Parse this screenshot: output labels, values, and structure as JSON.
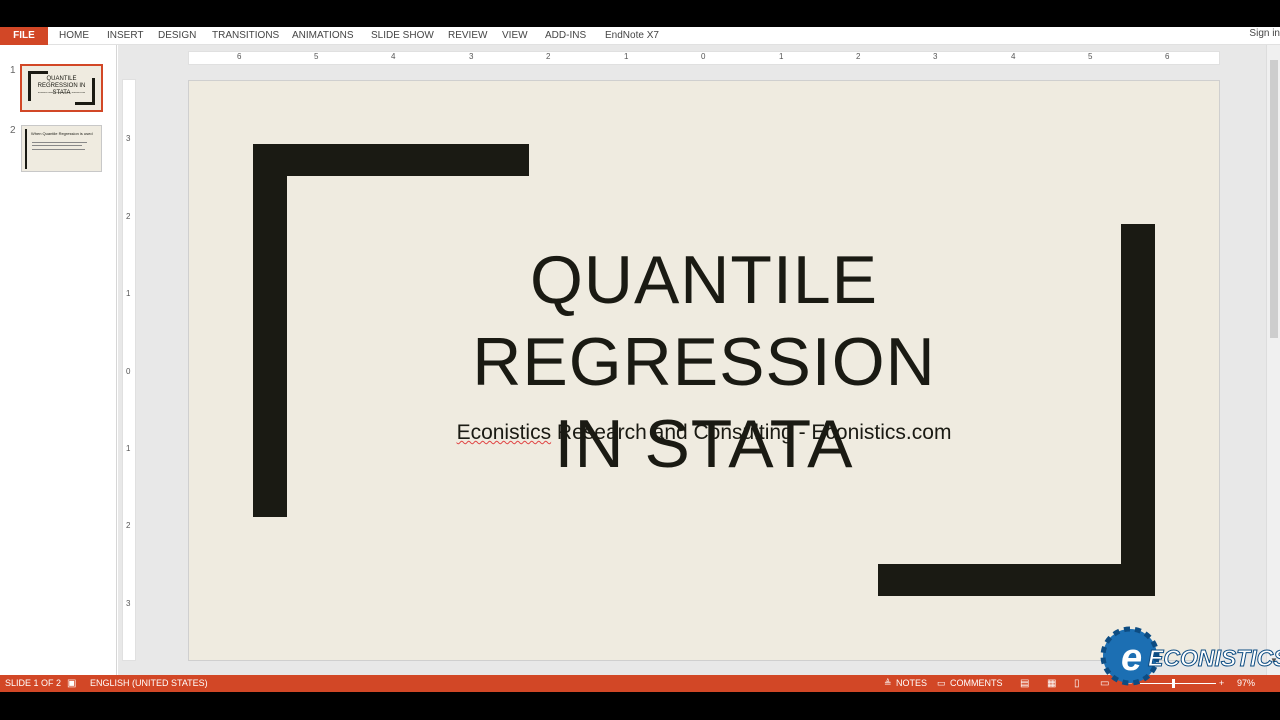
{
  "ribbon": {
    "file": "FILE",
    "tabs": [
      "HOME",
      "INSERT",
      "DESIGN",
      "TRANSITIONS",
      "ANIMATIONS",
      "SLIDE SHOW",
      "REVIEW",
      "VIEW",
      "ADD-INS",
      "EndNote X7"
    ],
    "signin": "Sign in"
  },
  "thumbnails": {
    "slide1": {
      "number": "1",
      "title": "QUANTILE REGRESSION IN STATA",
      "subtitle": "Econistics Research and Consulting - Econistics.com"
    },
    "slide2": {
      "number": "2",
      "title": "When Quantile Regression is used"
    }
  },
  "ruler": {
    "horizontal": [
      "6",
      "5",
      "4",
      "3",
      "2",
      "1",
      "0",
      "1",
      "2",
      "3",
      "4",
      "5",
      "6"
    ],
    "vertical": [
      "3",
      "2",
      "1",
      "0",
      "1",
      "2",
      "3"
    ]
  },
  "slide": {
    "title_line1": "QUANTILE REGRESSION",
    "title_line2": "IN STATA",
    "subtitle_word1": "Econistics",
    "subtitle_rest": " Research and Consulting - Econistics.com",
    "bar_color": "#1a1a13",
    "background_color": "#efebe0"
  },
  "status": {
    "slide_count": "SLIDE 1 OF 2",
    "language": "ENGLISH (UNITED STATES)",
    "notes": "NOTES",
    "comments": "COMMENTS",
    "zoom": "97%"
  },
  "logo": {
    "text": "ECONISTICS"
  },
  "colors": {
    "accent": "#d24726"
  }
}
